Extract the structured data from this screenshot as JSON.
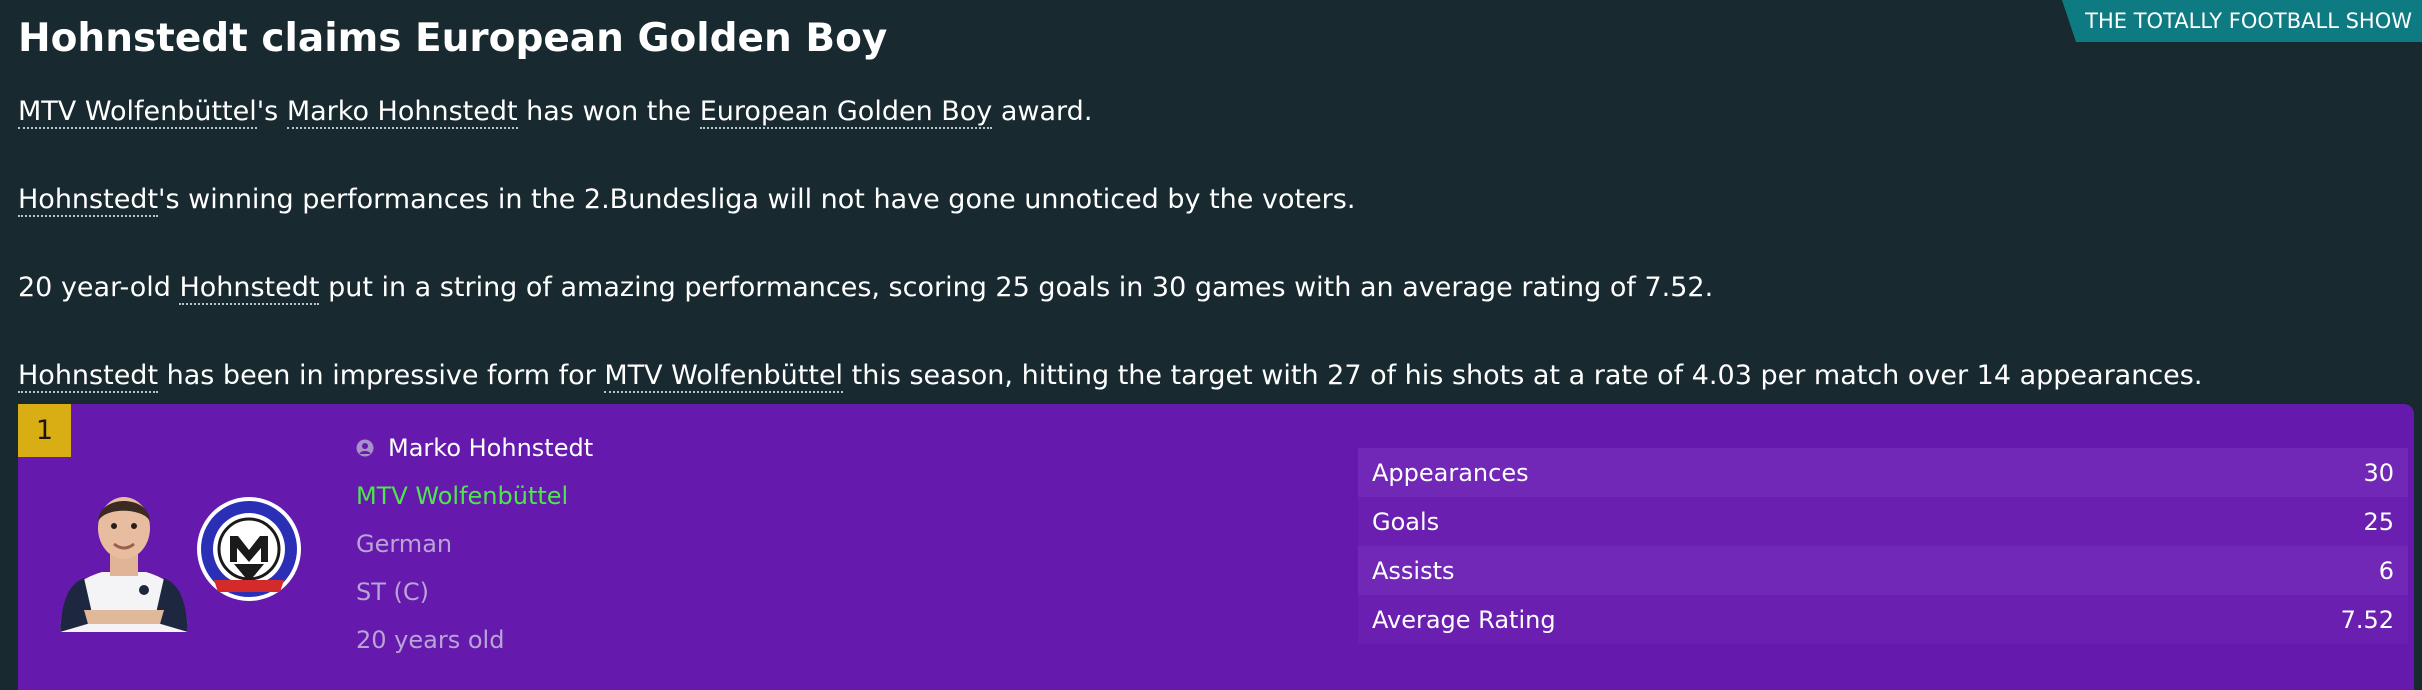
{
  "source_tag": "THE TOTALLY FOOTBALL SHOW",
  "headline": "Hohnstedt claims European Golden Boy",
  "paragraphs": {
    "p1": {
      "club": "MTV Wolfenbüttel",
      "t1": "'s ",
      "player": "Marko Hohnstedt",
      "t2": " has won the ",
      "award": "European Golden Boy",
      "t3": " award."
    },
    "p2": {
      "player": "Hohnstedt",
      "t1": "'s winning performances in the 2.Bundesliga will not have gone unnoticed by the voters."
    },
    "p3": {
      "t0": "20 year-old ",
      "player": "Hohnstedt",
      "t1": " put in a string of amazing performances, scoring 25 goals in 30 games with an average rating of 7.52."
    },
    "p4": {
      "player": "Hohnstedt",
      "t1": " has been in impressive form for ",
      "club": "MTV Wolfenbüttel",
      "t2": " this season, hitting the target with 27 of his shots at a rate of 4.03 per match over 14 appearances."
    }
  },
  "card": {
    "rank": "1",
    "name": "Marko Hohnstedt",
    "club": "MTV Wolfenbüttel",
    "nationality": "German",
    "position": "ST (C)",
    "age": "20 years old",
    "stats": [
      {
        "label": "Appearances",
        "value": "30"
      },
      {
        "label": "Goals",
        "value": "25"
      },
      {
        "label": "Assists",
        "value": "6"
      },
      {
        "label": "Average Rating",
        "value": "7.52"
      }
    ]
  },
  "colors": {
    "background": "#18292f",
    "card": "#6619ad",
    "rank_badge": "#d8ae14",
    "club_link": "#4ee64a",
    "source_tag": "#0e7b82"
  },
  "icons": {
    "player_status": "person-icon",
    "crest": "club-crest-icon"
  }
}
